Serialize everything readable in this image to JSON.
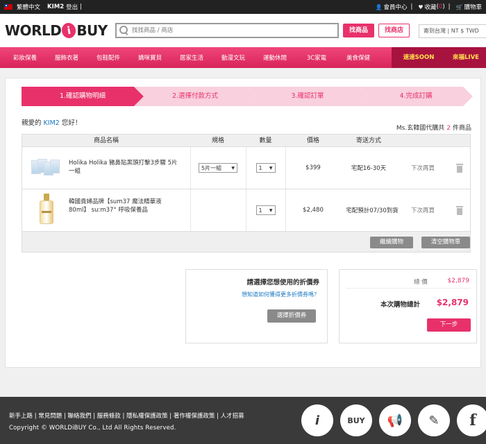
{
  "topbar": {
    "language": "繁體中文",
    "user": "KIM2",
    "logout": "登出",
    "member_center": "會員中心",
    "favorites": "收藏",
    "favorites_count": "0",
    "cart": "購物車"
  },
  "header": {
    "logo_left": "WORLD",
    "logo_badge": "i",
    "logo_right": "BUY",
    "search_placeholder": "找找商品 / 商店",
    "search_product": "找商品",
    "search_shop": "找商店",
    "ship_to": "寄到台灣 | NT $ TWD"
  },
  "categories": [
    "彩妝保養",
    "服飾衣著",
    "包鞋配件",
    "嬌咪寶貝",
    "居家生活",
    "動漫文玩",
    "運動休閒",
    "3C家電",
    "美食保健"
  ],
  "special_categories": {
    "soon": "速速SOON",
    "live": "來福LIVE"
  },
  "steps": [
    "1.確認購物明細",
    "2.選擇付款方式",
    "3.確認訂單",
    "4.完成訂購"
  ],
  "greeting": {
    "prefix": "親愛的",
    "name": "KIM2",
    "suffix": "您好！"
  },
  "summary": {
    "prefix": "Ms.玄韓國代購共",
    "count": "2",
    "suffix": "件商品"
  },
  "table": {
    "headers": [
      "商品名稱",
      "規格",
      "數量",
      "價格",
      "寄送方式"
    ],
    "rows": [
      {
        "name": "Holika Holika 豬鼻貼黑頭打擊3步驟 5片一組",
        "spec": "5片一組",
        "qty": "1",
        "price": "$399",
        "shipping": "宅配16-30天",
        "action": "下次再買"
      },
      {
        "name": "韓國貴婦品牌【sum37 魔法精華液 80ml】 su:m37° 呼吸保養品",
        "spec": "",
        "qty": "1",
        "price": "$2,480",
        "shipping": "宅配預計07/30到貨",
        "action": "下次再買"
      }
    ],
    "continue_shopping": "繼續購物",
    "clear_cart": "清空購物車"
  },
  "coupon": {
    "title": "請選擇您想使用的折價券",
    "link": "想知道如何獲得更多折價券嗎？",
    "button": "選擇折價券"
  },
  "total": {
    "total_label": "總 價",
    "total_value": "$2,879",
    "grand_label": "本次購物總計",
    "grand_value": "$2,879",
    "next": "下一步"
  },
  "footer": {
    "links": "新手上路 | 常見問題 | 聯絡我們 | 服務條款 | 隱私權保護政策 | 著作權保護政策 | 人才招募",
    "copyright": "Copyright © WORLDiBUY Co., Ltd All Rights Reserved.",
    "icons": [
      "i",
      "BUY",
      "📢",
      "✎",
      "f"
    ]
  },
  "colors": {
    "brand": "#e8316b",
    "link": "#1a78c2"
  }
}
